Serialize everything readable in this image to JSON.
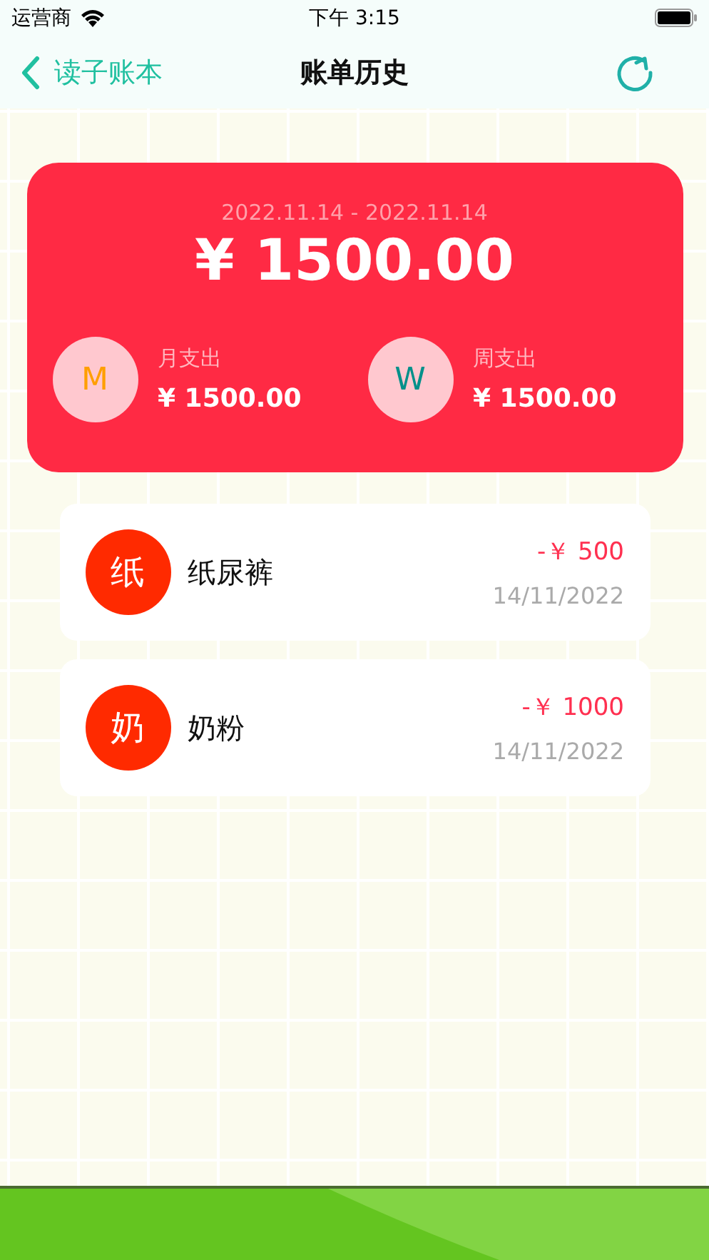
{
  "status_bar": {
    "carrier": "运营商",
    "time": "下午 3:15"
  },
  "nav": {
    "back_label": "读子账本",
    "title": "账单历史"
  },
  "summary": {
    "date_range": "2022.11.14 - 2022.11.14",
    "total": "¥ 1500.00",
    "stats": [
      {
        "letter": "M",
        "color": "#ff9f00",
        "label": "月支出",
        "amount": "¥ 1500.00"
      },
      {
        "letter": "W",
        "color": "#00908a",
        "label": "周支出",
        "amount": "¥ 1500.00"
      }
    ]
  },
  "records": [
    {
      "initial": "纸",
      "name": "纸尿裤",
      "amount": "-￥ 500",
      "date": "14/11/2022"
    },
    {
      "initial": "奶",
      "name": "奶粉",
      "amount": "-￥ 1000",
      "date": "14/11/2022"
    }
  ]
}
